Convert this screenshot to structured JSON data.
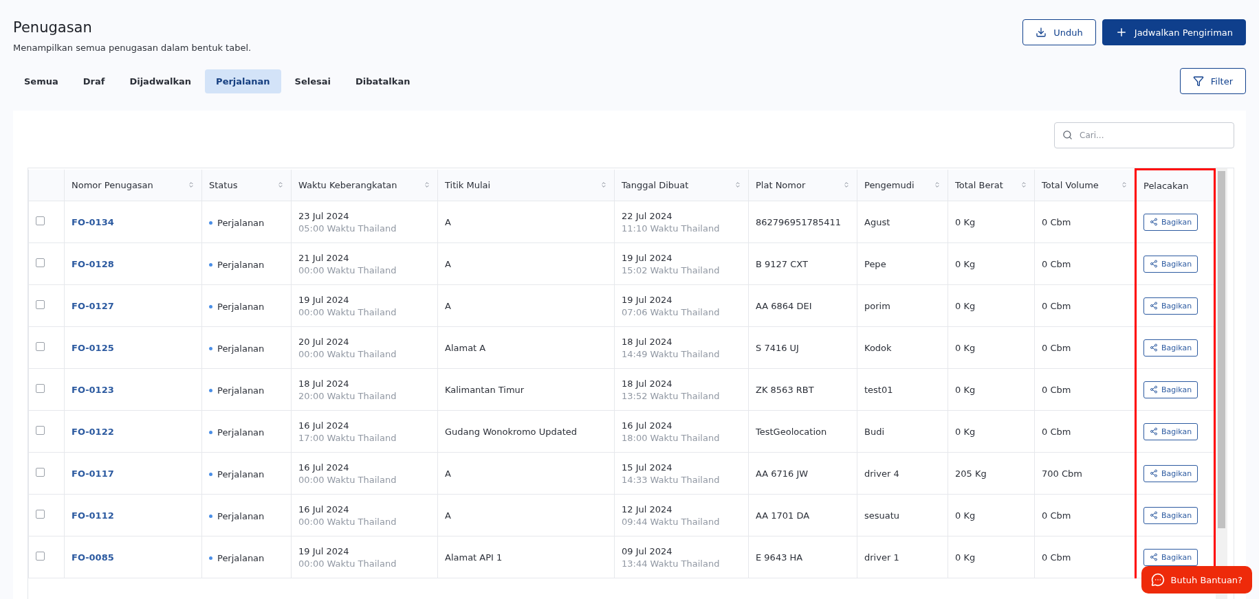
{
  "header": {
    "title": "Penugasan",
    "subtitle": "Menampilkan semua penugasan dalam bentuk tabel."
  },
  "actions": [
    {
      "kind": "download",
      "label": "Unduh"
    },
    {
      "kind": "add",
      "label": "Jadwalkan Pengiriman"
    }
  ],
  "tabs": [
    {
      "label": "Semua",
      "selected": false
    },
    {
      "label": "Draf",
      "selected": false
    },
    {
      "label": "Dijadwalkan",
      "selected": false
    },
    {
      "label": "Perjalanan",
      "selected": true
    },
    {
      "label": "Selesai",
      "selected": false
    },
    {
      "label": "Dibatalkan",
      "selected": false
    }
  ],
  "filter_button": {
    "label": "Filter"
  },
  "search": {
    "placeholder": "Cari..."
  },
  "table": {
    "columns": [
      {
        "label": "Nomor Penugasan",
        "sortable": true,
        "highlighted": false
      },
      {
        "label": "Status",
        "sortable": true,
        "highlighted": false
      },
      {
        "label": "Waktu Keberangkatan",
        "sortable": true,
        "highlighted": false
      },
      {
        "label": "Titik Mulai",
        "sortable": true,
        "highlighted": false
      },
      {
        "label": "Tanggal Dibuat",
        "sortable": true,
        "highlighted": false
      },
      {
        "label": "Plat Nomor",
        "sortable": true,
        "highlighted": false
      },
      {
        "label": "Pengemudi",
        "sortable": true,
        "highlighted": false
      },
      {
        "label": "Total Berat",
        "sortable": true,
        "highlighted": false
      },
      {
        "label": "Total Volume",
        "sortable": true,
        "highlighted": false
      },
      {
        "label": "Pelacakan",
        "sortable": false,
        "highlighted": true
      }
    ],
    "rows": [
      {
        "checked": false,
        "number": "FO-0134",
        "status": {
          "label": "Perjalanan",
          "color": "#4a8ee6"
        },
        "departure_date": "23 Jul 2024",
        "departure_time": "05:00 Waktu Thailand",
        "start": "A",
        "created_date": "22 Jul 2024",
        "created_time": "11:10 Waktu Thailand",
        "plate": "862796951785411",
        "driver": "Agust",
        "weight": "0 Kg",
        "volume": "0 Cbm",
        "action": "Bagikan"
      },
      {
        "checked": false,
        "number": "FO-0128",
        "status": {
          "label": "Perjalanan",
          "color": "#4a8ee6"
        },
        "departure_date": "21 Jul 2024",
        "departure_time": "00:00 Waktu Thailand",
        "start": "A",
        "created_date": "19 Jul 2024",
        "created_time": "15:02 Waktu Thailand",
        "plate": "B 9127 CXT",
        "driver": "Pepe",
        "weight": "0 Kg",
        "volume": "0 Cbm",
        "action": "Bagikan"
      },
      {
        "checked": false,
        "number": "FO-0127",
        "status": {
          "label": "Perjalanan",
          "color": "#4a8ee6"
        },
        "departure_date": "19 Jul 2024",
        "departure_time": "00:00 Waktu Thailand",
        "start": "A",
        "created_date": "19 Jul 2024",
        "created_time": "07:06 Waktu Thailand",
        "plate": "AA 6864 DEI",
        "driver": "porim",
        "weight": "0 Kg",
        "volume": "0 Cbm",
        "action": "Bagikan"
      },
      {
        "checked": false,
        "number": "FO-0125",
        "status": {
          "label": "Perjalanan",
          "color": "#4a8ee6"
        },
        "departure_date": "20 Jul 2024",
        "departure_time": "00:00 Waktu Thailand",
        "start": "Alamat A",
        "created_date": "18 Jul 2024",
        "created_time": "14:49 Waktu Thailand",
        "plate": "S 7416 UJ",
        "driver": "Kodok",
        "weight": "0 Kg",
        "volume": "0 Cbm",
        "action": "Bagikan"
      },
      {
        "checked": false,
        "number": "FO-0123",
        "status": {
          "label": "Perjalanan",
          "color": "#4a8ee6"
        },
        "departure_date": "18 Jul 2024",
        "departure_time": "20:00 Waktu Thailand",
        "start": "Kalimantan Timur",
        "created_date": "18 Jul 2024",
        "created_time": "13:52 Waktu Thailand",
        "plate": "ZK 8563 RBT",
        "driver": "test01",
        "weight": "0 Kg",
        "volume": "0 Cbm",
        "action": "Bagikan"
      },
      {
        "checked": false,
        "number": "FO-0122",
        "status": {
          "label": "Perjalanan",
          "color": "#4a8ee6"
        },
        "departure_date": "16 Jul 2024",
        "departure_time": "17:00 Waktu Thailand",
        "start": "Gudang Wonokromo Updated",
        "created_date": "16 Jul 2024",
        "created_time": "18:00 Waktu Thailand",
        "plate": "TestGeolocation",
        "driver": "Budi",
        "weight": "0 Kg",
        "volume": "0 Cbm",
        "action": "Bagikan"
      },
      {
        "checked": false,
        "number": "FO-0117",
        "status": {
          "label": "Perjalanan",
          "color": "#4a8ee6"
        },
        "departure_date": "16 Jul 2024",
        "departure_time": "00:00 Waktu Thailand",
        "start": "A",
        "created_date": "15 Jul 2024",
        "created_time": "14:33 Waktu Thailand",
        "plate": "AA 6716 JW",
        "driver": "driver 4",
        "weight": "205 Kg",
        "volume": "700 Cbm",
        "action": "Bagikan"
      },
      {
        "checked": false,
        "number": "FO-0112",
        "status": {
          "label": "Perjalanan",
          "color": "#4a8ee6"
        },
        "departure_date": "16 Jul 2024",
        "departure_time": "00:00 Waktu Thailand",
        "start": "A",
        "created_date": "12 Jul 2024",
        "created_time": "09:44 Waktu Thailand",
        "plate": "AA 1701 DA",
        "driver": "sesuatu",
        "weight": "0 Kg",
        "volume": "0 Cbm",
        "action": "Bagikan"
      },
      {
        "checked": false,
        "number": "FO-0085",
        "status": {
          "label": "Perjalanan",
          "color": "#4a8ee6"
        },
        "departure_date": "19 Jul 2024",
        "departure_time": "00:00 Waktu Thailand",
        "start": "Alamat API 1",
        "created_date": "09 Jul 2024",
        "created_time": "13:44 Waktu Thailand",
        "plate": "E 9643 HA",
        "driver": "driver 1",
        "weight": "0 Kg",
        "volume": "0 Cbm",
        "action": "Bagikan"
      }
    ]
  },
  "help_button": {
    "label": "Butuh Bantuan?"
  }
}
